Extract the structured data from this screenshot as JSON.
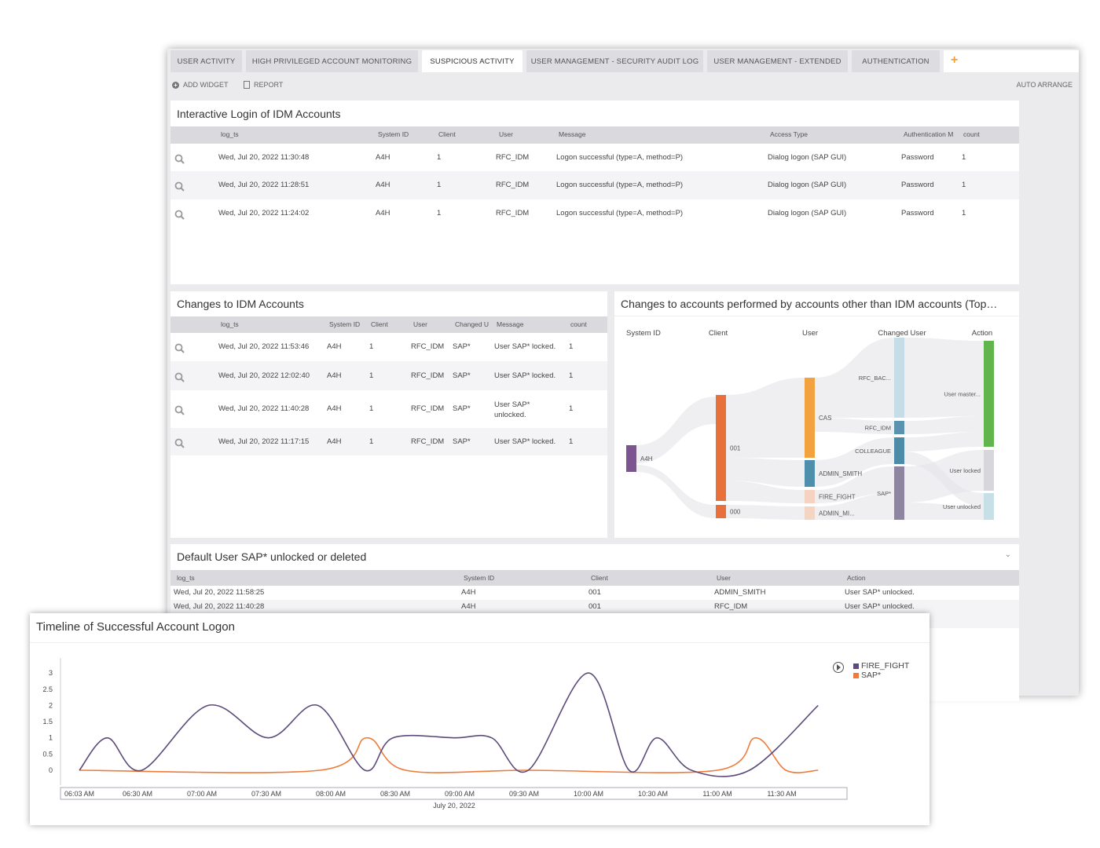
{
  "tabs": [
    {
      "label": "USER ACTIVITY"
    },
    {
      "label": "HIGH PRIVILEGED ACCOUNT MONITORING"
    },
    {
      "label": "SUSPICIOUS ACTIVITY",
      "active": true
    },
    {
      "label": "USER MANAGEMENT - SECURITY AUDIT LOG"
    },
    {
      "label": "USER MANAGEMENT - EXTENDED"
    },
    {
      "label": "AUTHENTICATION"
    }
  ],
  "add_tab_icon": "plus-icon",
  "accent": "#f5a032",
  "toolbar": {
    "add_widget": "ADD WIDGET",
    "report": "REPORT",
    "auto_arrange": "AUTO ARRANGE"
  },
  "idm_logins": {
    "title": "Interactive Login of IDM Accounts",
    "columns": [
      "log_ts",
      "System ID",
      "Client",
      "User",
      "Message",
      "Access Type",
      "Authentication M",
      "count"
    ],
    "rows": [
      [
        "Wed, Jul 20, 2022 11:30:48",
        "A4H",
        "1",
        "RFC_IDM",
        "Logon successful (type=A, method=P)",
        "Dialog logon (SAP GUI)",
        "Password",
        "1"
      ],
      [
        "Wed, Jul 20, 2022 11:28:51",
        "A4H",
        "1",
        "RFC_IDM",
        "Logon successful (type=A, method=P)",
        "Dialog logon (SAP GUI)",
        "Password",
        "1"
      ],
      [
        "Wed, Jul 20, 2022 11:24:02",
        "A4H",
        "1",
        "RFC_IDM",
        "Logon successful (type=A, method=P)",
        "Dialog logon (SAP GUI)",
        "Password",
        "1"
      ]
    ]
  },
  "idm_changes": {
    "title": "Changes to IDM Accounts",
    "columns": [
      "log_ts",
      "System ID",
      "Client",
      "User",
      "Changed U",
      "Message",
      "count"
    ],
    "rows": [
      [
        "Wed, Jul 20, 2022 11:53:46",
        "A4H",
        "1",
        "RFC_IDM",
        "SAP*",
        "User SAP* locked.",
        "1"
      ],
      [
        "Wed, Jul 20, 2022 12:02:40",
        "A4H",
        "1",
        "RFC_IDM",
        "SAP*",
        "User SAP* locked.",
        "1"
      ],
      [
        "Wed, Jul 20, 2022 11:40:28",
        "A4H",
        "1",
        "RFC_IDM",
        "SAP*",
        "User SAP* unlocked.",
        "1"
      ],
      [
        "Wed, Jul 20, 2022 11:17:15",
        "A4H",
        "1",
        "RFC_IDM",
        "SAP*",
        "User SAP* locked.",
        "1"
      ]
    ]
  },
  "other_changes": {
    "title": "Changes to accounts performed by accounts other than IDM accounts (Top…",
    "chart_data": {
      "type": "sankey",
      "columns": [
        "System ID",
        "Client",
        "User",
        "Changed User",
        "Action"
      ],
      "nodes": [
        {
          "label": "A4H",
          "column": 0,
          "color": "#7b5490"
        },
        {
          "label": "001",
          "column": 1,
          "color": "#e8703a"
        },
        {
          "label": "000",
          "column": 1,
          "color": "#e8703a"
        },
        {
          "label": "CAS",
          "column": 2,
          "color": "#f2a23f"
        },
        {
          "label": "ADMIN_SMITH",
          "column": 2,
          "color": "#4f8fac"
        },
        {
          "label": "FIRE_FIGHT",
          "column": 2,
          "color": "#f6d3c0"
        },
        {
          "label": "ADMIN_MI...",
          "column": 2,
          "color": "#f4d5c4"
        },
        {
          "label": "RFC_BAC...",
          "column": 3,
          "color": "#c5dde6"
        },
        {
          "label": "RFC_IDM",
          "column": 3,
          "color": "#5a93b0"
        },
        {
          "label": "COLLEAGUE",
          "column": 3,
          "color": "#4d8ba8"
        },
        {
          "label": "SAP*",
          "column": 3,
          "color": "#8e86a0"
        },
        {
          "label": "User master...",
          "column": 4,
          "color": "#62b44c"
        },
        {
          "label": "User locked",
          "column": 4,
          "color": "#d6d6dc"
        },
        {
          "label": "User unlocked",
          "column": 4,
          "color": "#c7dfe7"
        }
      ],
      "links": [
        [
          "A4H",
          "001"
        ],
        [
          "A4H",
          "000"
        ],
        [
          "001",
          "CAS"
        ],
        [
          "001",
          "ADMIN_SMITH"
        ],
        [
          "001",
          "FIRE_FIGHT"
        ],
        [
          "000",
          "ADMIN_MI..."
        ],
        [
          "CAS",
          "RFC_BAC..."
        ],
        [
          "CAS",
          "RFC_IDM"
        ],
        [
          "ADMIN_SMITH",
          "COLLEAGUE"
        ],
        [
          "FIRE_FIGHT",
          "SAP*"
        ],
        [
          "ADMIN_MI...",
          "SAP*"
        ],
        [
          "RFC_BAC...",
          "User master..."
        ],
        [
          "RFC_IDM",
          "User master..."
        ],
        [
          "COLLEAGUE",
          "User master..."
        ],
        [
          "COLLEAGUE",
          "User unlocked"
        ],
        [
          "SAP*",
          "User locked"
        ],
        [
          "SAP*",
          "User unlocked"
        ]
      ]
    }
  },
  "sap_unlocked": {
    "title": "Default User SAP* unlocked or deleted",
    "columns": [
      "log_ts",
      "System ID",
      "Client",
      "User",
      "Action"
    ],
    "rows": [
      [
        "Wed, Jul 20, 2022 11:58:25",
        "A4H",
        "001",
        "ADMIN_SMITH",
        "User SAP* unlocked."
      ],
      [
        "Wed, Jul 20, 2022 11:40:28",
        "A4H",
        "001",
        "RFC_IDM",
        "User SAP* unlocked."
      ]
    ]
  },
  "timeline": {
    "title": "Timeline of Successful Account Logon",
    "chart_data": {
      "type": "line",
      "xlabel": "July 20, 2022",
      "x_ticks": [
        "06:03 AM",
        "06:30 AM",
        "07:00 AM",
        "07:30 AM",
        "08:00 AM",
        "08:30 AM",
        "09:00 AM",
        "09:30 AM",
        "10:00 AM",
        "10:30 AM",
        "11:00 AM",
        "11:30 AM"
      ],
      "y_ticks": [
        "0",
        "0.5",
        "1",
        "1.5",
        "2",
        "2.5",
        "3"
      ],
      "ylim": [
        0,
        3
      ],
      "legend": "top-right",
      "series": [
        {
          "name": "FIRE_FIGHT",
          "color": "#5b4a7a",
          "x": [
            "06:03",
            "06:16",
            "06:32",
            "07:03",
            "07:31",
            "07:54",
            "08:16",
            "08:29",
            "08:58",
            "09:15",
            "09:32",
            "10:00",
            "10:19",
            "10:32",
            "10:48",
            "11:15",
            "11:47"
          ],
          "values": [
            0,
            1,
            0,
            2,
            1,
            2,
            0,
            1,
            1,
            1,
            0,
            3,
            0,
            1,
            0,
            0,
            2
          ]
        },
        {
          "name": "SAP*",
          "color": "#ef7b3a",
          "x": [
            "06:03",
            "07:55",
            "08:17",
            "08:35",
            "09:32",
            "11:00",
            "11:18",
            "11:32",
            "11:47"
          ],
          "values": [
            0,
            0,
            1,
            0,
            0,
            0,
            1,
            0,
            0
          ]
        }
      ]
    }
  }
}
